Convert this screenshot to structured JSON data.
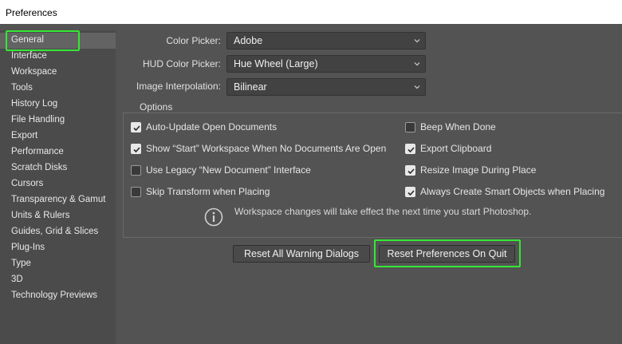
{
  "window": {
    "title": "Preferences"
  },
  "sidebar": {
    "items": [
      {
        "label": "General",
        "selected": true
      },
      {
        "label": "Interface"
      },
      {
        "label": "Workspace"
      },
      {
        "label": "Tools"
      },
      {
        "label": "History Log"
      },
      {
        "label": "File Handling"
      },
      {
        "label": "Export"
      },
      {
        "label": "Performance"
      },
      {
        "label": "Scratch Disks"
      },
      {
        "label": "Cursors"
      },
      {
        "label": "Transparency & Gamut"
      },
      {
        "label": "Units & Rulers"
      },
      {
        "label": "Guides, Grid & Slices"
      },
      {
        "label": "Plug-Ins"
      },
      {
        "label": "Type"
      },
      {
        "label": "3D"
      },
      {
        "label": "Technology Previews"
      }
    ]
  },
  "fields": {
    "color_picker": {
      "label": "Color Picker:",
      "value": "Adobe"
    },
    "hud_color_picker": {
      "label": "HUD Color Picker:",
      "value": "Hue Wheel (Large)"
    },
    "image_interpolation": {
      "label": "Image Interpolation:",
      "value": "Bilinear"
    }
  },
  "options": {
    "title": "Options",
    "left": [
      {
        "label": "Auto-Update Open Documents",
        "checked": true
      },
      {
        "label": "Show “Start” Workspace When No Documents Are Open",
        "checked": true
      },
      {
        "label": "Use Legacy “New Document” Interface",
        "checked": false
      },
      {
        "label": "Skip Transform when Placing",
        "checked": false
      }
    ],
    "right": [
      {
        "label": "Beep When Done",
        "checked": false
      },
      {
        "label": "Export Clipboard",
        "checked": true
      },
      {
        "label": "Resize Image During Place",
        "checked": true
      },
      {
        "label": "Always Create Smart Objects when Placing",
        "checked": true
      }
    ],
    "info": "Workspace changes will take effect the next time you start Photoshop."
  },
  "buttons": {
    "reset_warnings": "Reset All Warning Dialogs",
    "reset_prefs": "Reset Preferences On Quit"
  },
  "colors": {
    "highlight": "#34e834",
    "panel_bg": "#535353",
    "sidebar_bg": "#4b4b4b",
    "selected_bg": "#636363"
  }
}
